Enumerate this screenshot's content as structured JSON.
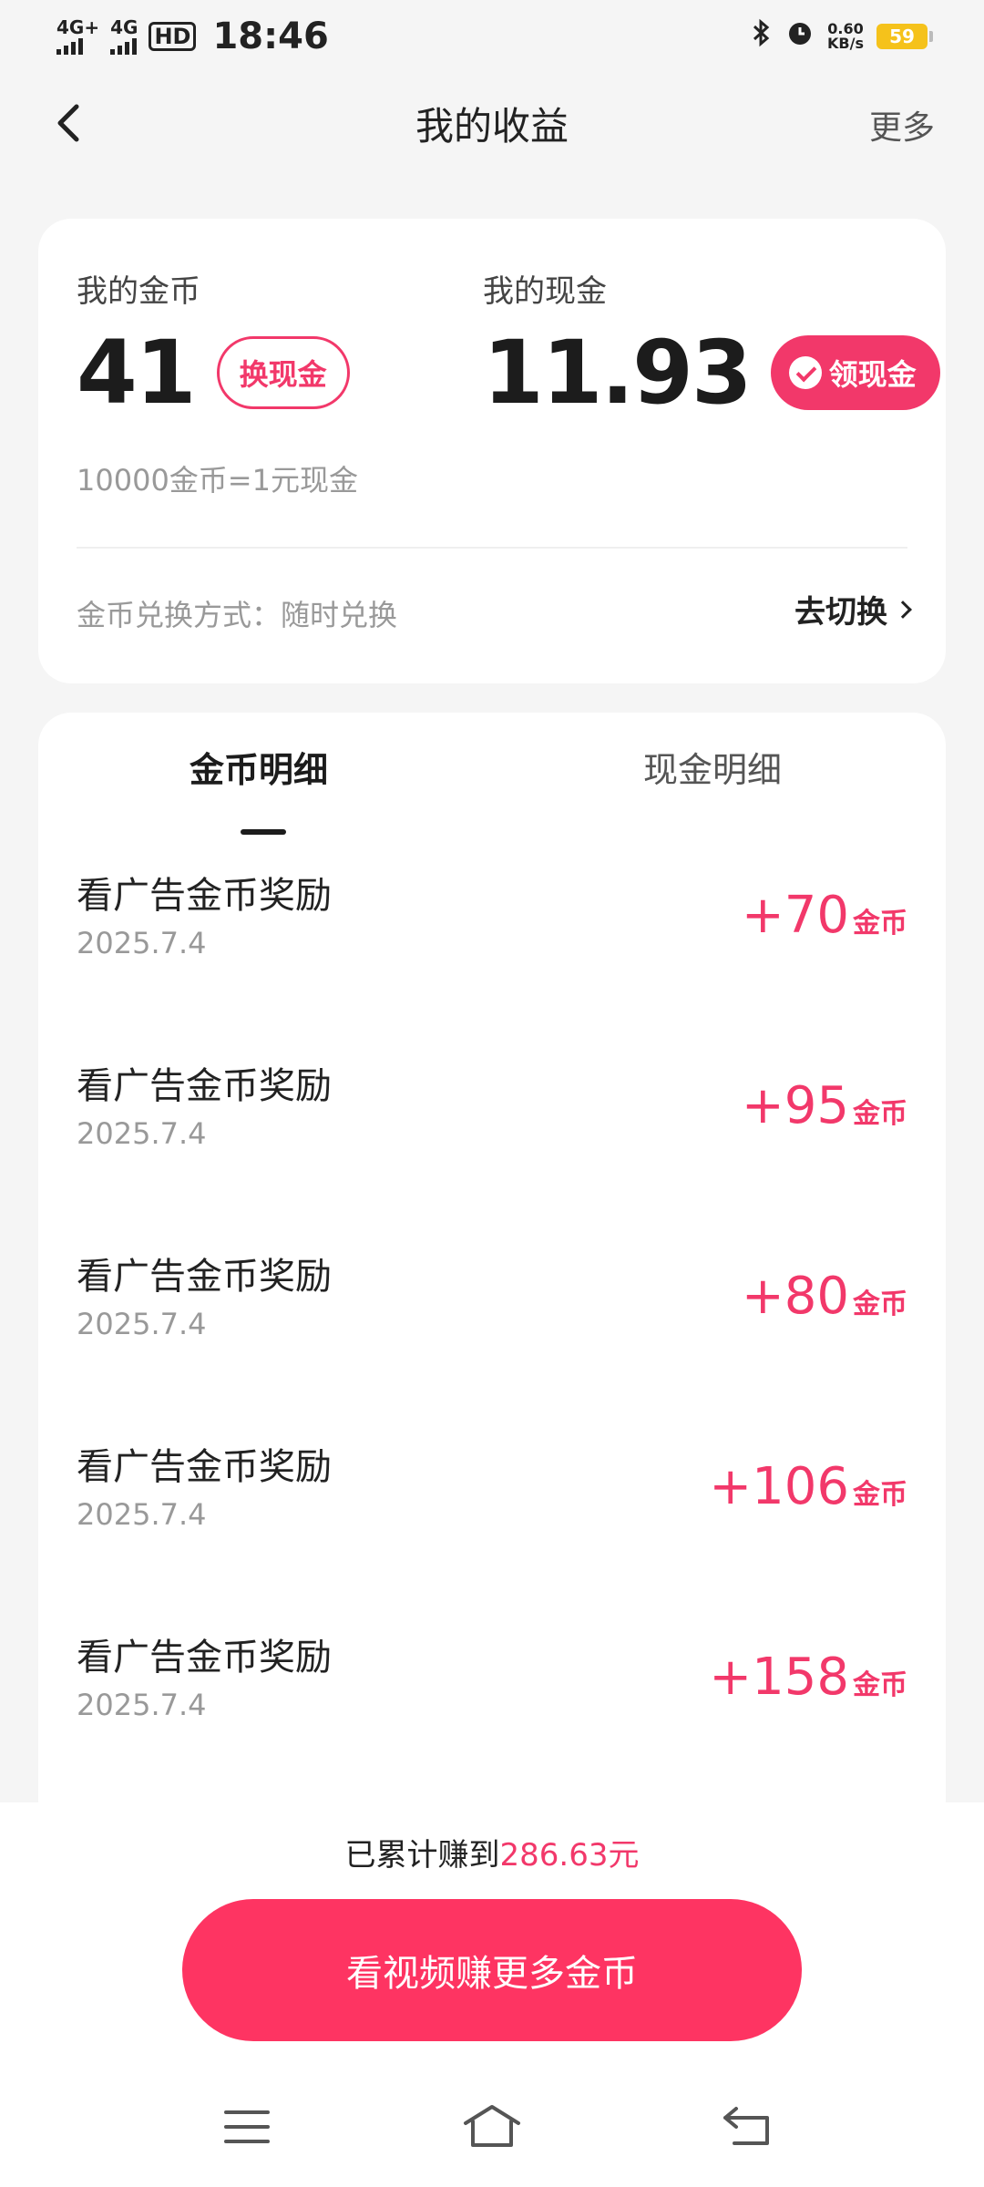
{
  "status_bar": {
    "signal1": "4G+",
    "signal2": "4G",
    "hd": "HD",
    "time": "18:46",
    "speed_value": "0.60",
    "speed_unit": "KB/s",
    "battery": "59"
  },
  "header": {
    "title": "我的收益",
    "more": "更多"
  },
  "balance": {
    "coins_label": "我的金币",
    "coins_value": "41",
    "exchange_button": "换现金",
    "cash_label": "我的现金",
    "cash_value": "11.93",
    "withdraw_button": "领现金",
    "rate_text": "10000金币=1元现金",
    "exchange_mode": "金币兑换方式：随时兑换",
    "switch_link": "去切换"
  },
  "tabs": {
    "coin_detail": "金币明细",
    "cash_detail": "现金明细"
  },
  "records": [
    {
      "title": "看广告金币奖励",
      "date": "2025.7.4",
      "amount": "+70",
      "unit": "金币"
    },
    {
      "title": "看广告金币奖励",
      "date": "2025.7.4",
      "amount": "+95",
      "unit": "金币"
    },
    {
      "title": "看广告金币奖励",
      "date": "2025.7.4",
      "amount": "+80",
      "unit": "金币"
    },
    {
      "title": "看广告金币奖励",
      "date": "2025.7.4",
      "amount": "+106",
      "unit": "金币"
    },
    {
      "title": "看广告金币奖励",
      "date": "2025.7.4",
      "amount": "+158",
      "unit": "金币"
    }
  ],
  "footer": {
    "total_prefix": "已累计赚到",
    "total_value": "286.63元",
    "cta": "看视频赚更多金币"
  },
  "colors": {
    "accent": "#f2386a",
    "cta": "#fe3462",
    "background": "#f5f5f5"
  }
}
